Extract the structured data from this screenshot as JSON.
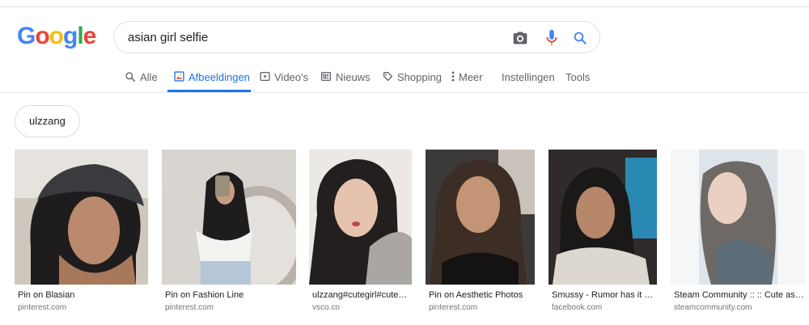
{
  "logo": {
    "letters": [
      "G",
      "o",
      "o",
      "g",
      "l",
      "e"
    ],
    "colors": [
      "#4285F4",
      "#EA4335",
      "#FBBC05",
      "#4285F4",
      "#34A853",
      "#EA4335"
    ]
  },
  "search": {
    "query": "asian girl selfie",
    "icons": [
      "camera-icon",
      "microphone-icon",
      "search-icon"
    ]
  },
  "tabs": [
    {
      "label": "Alle",
      "icon": "search-icon"
    },
    {
      "label": "Afbeeldingen",
      "icon": "image-icon",
      "active": true
    },
    {
      "label": "Video's",
      "icon": "video-icon"
    },
    {
      "label": "Nieuws",
      "icon": "news-icon"
    },
    {
      "label": "Shopping",
      "icon": "tag-icon"
    },
    {
      "label": "Meer",
      "icon": "more-vert-icon"
    },
    {
      "label": "Instellingen"
    },
    {
      "label": "Tools"
    }
  ],
  "chip": {
    "label": "ulzzang"
  },
  "results": [
    {
      "caption": "Pin on Blasian",
      "source": "pinterest.com"
    },
    {
      "caption": "Pin on Fashion Line",
      "source": "pinterest.com"
    },
    {
      "caption": "ulzzang#cutegirl#cute…",
      "source": "vsco.co"
    },
    {
      "caption": "Pin on Aesthetic Photos",
      "source": "pinterest.com"
    },
    {
      "caption": "Smussy - Rumor has it #…",
      "source": "facebook.com"
    },
    {
      "caption": "Steam Community :: :: Cute asi…",
      "source": "steamcommunity.com"
    }
  ],
  "colors": {
    "accent": "#1a73e8",
    "muted": "#5f6368",
    "border": "#dfe1e5"
  }
}
